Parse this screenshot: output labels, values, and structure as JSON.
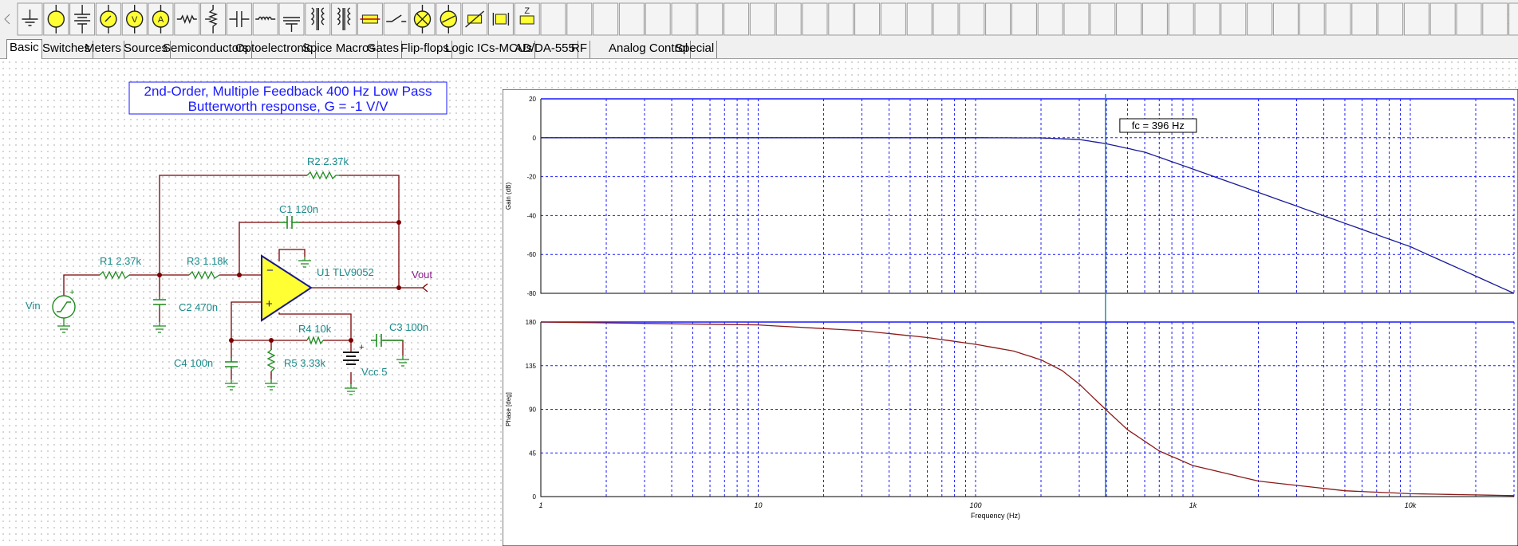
{
  "toolbar": {
    "icons": [
      "ground-icon",
      "voltage-source-icon",
      "battery-icon",
      "voltmeter-icon",
      "voltmeter-v-icon",
      "ammeter-icon",
      "resistor-icon",
      "potentiometer-icon",
      "capacitor-icon",
      "inductor-icon",
      "variable-capacitor-icon",
      "transformer-icon",
      "transformer-2-icon",
      "fuse-icon",
      "switch-icon",
      "lamp-icon",
      "motor-icon",
      "varistor-icon",
      "crystal-icon",
      "impedance-icon"
    ],
    "impedance_label": "Z"
  },
  "tabs": [
    {
      "label": "Basic",
      "active": true
    },
    {
      "label": "Switches"
    },
    {
      "label": "Meters"
    },
    {
      "label": "Sources"
    },
    {
      "label": "Semiconductors"
    },
    {
      "label": "Optoelectronic"
    },
    {
      "label": "Spice Macros"
    },
    {
      "label": "Gates"
    },
    {
      "label": "Flip-flops"
    },
    {
      "label": "Logic ICs-MCUs"
    },
    {
      "label": "AD/DA-555"
    },
    {
      "label": "RF"
    },
    {
      "label": "Analog Control"
    },
    {
      "label": "Special"
    }
  ],
  "schematic": {
    "title_line1": "2nd-Order, Multiple Feedback 400 Hz Low Pass",
    "title_line2": "Butterworth response, G = -1 V/V",
    "labels": {
      "r2": "R2 2.37k",
      "c1": "C1 120n",
      "r1": "R1 2.37k",
      "r3": "R3 1.18k",
      "u1": "U1 TLV9052",
      "vout": "Vout",
      "vin": "Vin",
      "c2": "C2 470n",
      "r4": "R4 10k",
      "c3": "C3 100n",
      "c4": "C4 100n",
      "r5": "R5 3.33k",
      "vcc": "Vcc 5"
    }
  },
  "chart_data": [
    {
      "type": "line",
      "ylabel": "Gain (dB)",
      "xscale": "log",
      "xlim": [
        1,
        30000
      ],
      "ylim": [
        -80,
        20
      ],
      "yticks": [
        20,
        0,
        -20,
        -40,
        -60,
        -80
      ],
      "grid": true,
      "annotation": "fc = 396 Hz",
      "cursor_x": 396,
      "series": [
        {
          "color": "#1a1a9a",
          "x": [
            1,
            10,
            100,
            200,
            300,
            396,
            600,
            1000,
            2000,
            5000,
            10000,
            30000
          ],
          "y": [
            0,
            0,
            0,
            -0.1,
            -0.9,
            -3,
            -7.4,
            -16.1,
            -28.1,
            -44,
            -56,
            -80
          ]
        }
      ]
    },
    {
      "type": "line",
      "xlabel": "Frequency (Hz)",
      "ylabel": "Phase [deg]",
      "xscale": "log",
      "xlim": [
        1,
        30000
      ],
      "ylim": [
        0,
        180
      ],
      "yticks": [
        180,
        135,
        90,
        45,
        0
      ],
      "xticks": [
        "1",
        "10",
        "100",
        "1k",
        "10k"
      ],
      "grid": true,
      "series": [
        {
          "color": "#8b1a1a",
          "x": [
            1,
            10,
            30,
            60,
            100,
            150,
            200,
            250,
            300,
            396,
            500,
            700,
            1000,
            2000,
            5000,
            10000,
            30000
          ],
          "y": [
            180,
            177,
            171,
            164,
            157,
            150,
            141,
            130,
            116,
            90,
            69,
            47,
            32,
            16,
            6,
            3,
            1
          ]
        }
      ]
    }
  ]
}
